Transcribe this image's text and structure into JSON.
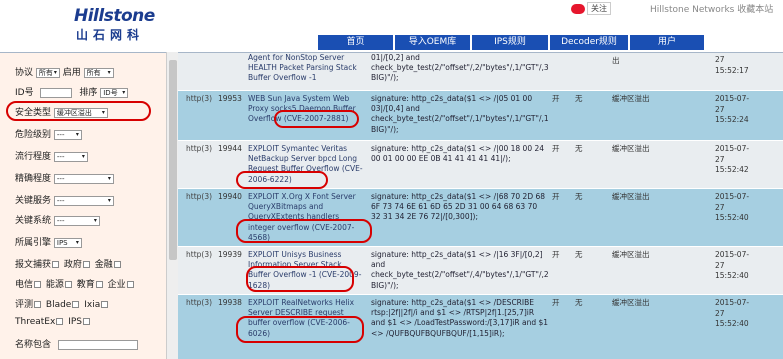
{
  "header": {
    "logo_en": "Hillstone",
    "logo_cn": "山石网科",
    "weibo_label": "关注",
    "site_link": "Hillstone Networks 收藏本站"
  },
  "nav": [
    {
      "label": "首页"
    },
    {
      "label": "导入OEM库"
    },
    {
      "label": "IPS规则"
    },
    {
      "label": "Decoder规则"
    },
    {
      "label": "用户"
    }
  ],
  "sidebar": {
    "protocol_label": "协议",
    "protocol_value": "所有",
    "enable_label": "启用",
    "enable_value": "所有",
    "id_label": "ID号",
    "sort_label": "排序",
    "sort_value": "ID号",
    "security_type_label": "安全类型",
    "security_type_value": "缓冲区溢出",
    "danger_label": "危险级别",
    "danger_value": "---",
    "popularity_label": "流行程度",
    "popularity_value": "---",
    "accuracy_label": "精确程度",
    "accuracy_value": "---",
    "key_service_label": "关键服务",
    "key_service_value": "---",
    "key_system_label": "关键系统",
    "key_system_value": "---",
    "engine_label": "所属引擎",
    "engine_value": "IPS",
    "missed_label": "报文捕获",
    "gov_label": "政府",
    "finance_label": "金融",
    "telecom_label": "电信",
    "energy_label": "能源",
    "edu_label": "教育",
    "enterprise_label": "企业",
    "eval_label": "评测",
    "blade_label": "Blade",
    "ixia_label": "Ixia",
    "threatex_label": "ThreatEx",
    "ips_label": "IPS",
    "name_contains_label": "名称包含"
  },
  "rows": [
    {
      "proto": "",
      "id": "",
      "name": "Agent for NonStop Server HEALTH Packet Parsing Stack Buffer Overflow -1",
      "sig": "01|/[0,2] and check_byte_test(2/\"offset\"/,2/\"bytes\"/,1/\"GT\"/,32127/\"value\"/,0x1/\"flag(REL BIG)\"/);",
      "a": "",
      "b": "",
      "cat": "出",
      "date": "27\n15:52:17"
    },
    {
      "proto": "http(3)",
      "id": "19953",
      "name": "WEB Sun Java System Web Proxy socks5 Daemon Buffer Overflow (CVE-2007-2881)",
      "sig": "signature: http_c2s_data($1 <> /|05 01 00 03|/[0,4] and check_byte_test(2/\"offset\"/,1/\"bytes\"/,1/\"GT\"/,136/\"value\"/,0x1/\"flag(REL BIG)\"/);",
      "a": "开",
      "b": "无",
      "cat": "缓冲区溢出",
      "date": "2015-07-\n27\n15:52:24"
    },
    {
      "proto": "http(3)",
      "id": "19944",
      "name": "EXPLOIT Symantec Veritas NetBackup Server bpcd Long Request Buffer Overflow (CVE-2006-6222)",
      "sig": "signature: http_c2s_data($1 <> /|00 18 00 24 00 01 00 00 EE 0B 41 41 41 41 41|/);",
      "a": "开",
      "b": "无",
      "cat": "缓冲区溢出",
      "date": "2015-07-\n27\n15:52:42"
    },
    {
      "proto": "http(3)",
      "id": "19940",
      "name": "EXPLOIT X.Org X Font Server QueryXBitmaps and QueryXExtents handlers integer overflow (CVE-2007-4568)",
      "sig": "signature: http_c2s_data($1 <> /|68 70 2D 68 6F 73 74 6E 61 6D 65 2D 31 00 64 68 63 70 32 31 34 2E 76 72|/[0,300]);",
      "a": "开",
      "b": "无",
      "cat": "缓冲区溢出",
      "date": "2015-07-\n27\n15:52:40"
    },
    {
      "proto": "http(3)",
      "id": "19939",
      "name": "EXPLOIT Unisys Business Information Server Stack Buffer Overflow -1 (CVE-2009-1628)",
      "sig": "signature: http_c2s_data($1 <> /|16 3F|/[0,2] and check_byte_test(2/\"offset\"/,4/\"bytes\"/,1/\"GT\"/,24/\"value\"/,0x1/\"flag(REL BIG)\"/);",
      "a": "开",
      "b": "无",
      "cat": "缓冲区溢出",
      "date": "2015-07-\n27\n15:52:40"
    },
    {
      "proto": "http(3)",
      "id": "19938",
      "name": "EXPLOIT RealNetworks Helix Server DESCRIBE request buffer overflow (CVE-2006-6026)",
      "sig": "signature: http_c2s_data($1 <> /DESCRIBE rtsp:|2f||2f|/i and $1 <> /RTSP|2f|1.[25,7]iR and $1 <> /LoadTestPassword:/[3,17]iR and $1 <> /QUFBQUFBQUFBQUF/[1,15]iR);",
      "a": "开",
      "b": "无",
      "cat": "缓冲区溢出",
      "date": "2015-07-\n27\n15:52:40"
    }
  ],
  "colors": {
    "row_even": "#e9edf0",
    "row_odd": "#a6cfe1",
    "nav_bg": "#1a4fb3",
    "sidebar_bg": "#fff2ea",
    "highlight": "#d70000"
  }
}
